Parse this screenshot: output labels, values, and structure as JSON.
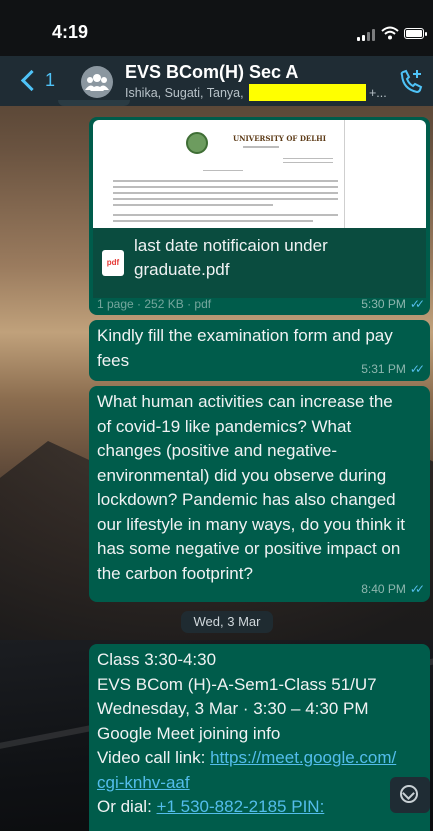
{
  "status": {
    "time": "4:19"
  },
  "header": {
    "back_count": "1",
    "group_name": "EVS BCom(H) Sec A",
    "members": "Ishika, Sugati, Tanya,",
    "members_more": "+..."
  },
  "colors": {
    "bubble_outgoing": "#005c4b",
    "header_bg": "#1f2c34",
    "accent": "#4fc3f7",
    "read_ticks": "#53bdeb",
    "redaction": "#ffff00"
  },
  "icons": [
    "back-chevron-icon",
    "group-avatar-icon",
    "add-call-icon",
    "pdf-icon",
    "double-tick-icon",
    "scroll-down-icon"
  ],
  "doc_preview": {
    "university": "UNIVERSITY OF DELHI"
  },
  "messages": [
    {
      "type": "document",
      "file_name_line1": "last date notificaion under",
      "file_name_line2": "graduate.pdf",
      "file_info": "1 page · 252 KB · pdf",
      "time": "5:30 PM",
      "status": "read"
    },
    {
      "type": "text",
      "lines": [
        "Kindly fill the examination form and pay",
        "fees"
      ],
      "time": "5:31 PM",
      "status": "read"
    },
    {
      "type": "text",
      "lines": [
        "What human activities can increase the",
        "of covid-19 like pandemics? What",
        "changes (positive and negative-",
        "environmental) did you observe during",
        "lockdown? Pandemic has also changed",
        "our lifestyle in many ways, do you think it",
        "has some negative or positive impact on",
        "the carbon footprint?"
      ],
      "time": "8:40 PM",
      "status": "read"
    }
  ],
  "date_separator": "Wed, 3 Mar",
  "meeting": {
    "line1": "Class 3:30-4:30",
    "line2": "EVS BCom (H)-A-Sem1-Class 51/U7",
    "line3": "Wednesday, 3 Mar · 3:30 – 4:30 PM",
    "line4": "Google Meet joining info",
    "video_prefix": "Video call link: ",
    "video_link_part1": "https://meet.google.com/",
    "video_link_part2": "cgi-knhv-aaf",
    "dial_prefix": "Or dial: ",
    "dial_link": "+1 530-882-2185 PIN:"
  }
}
